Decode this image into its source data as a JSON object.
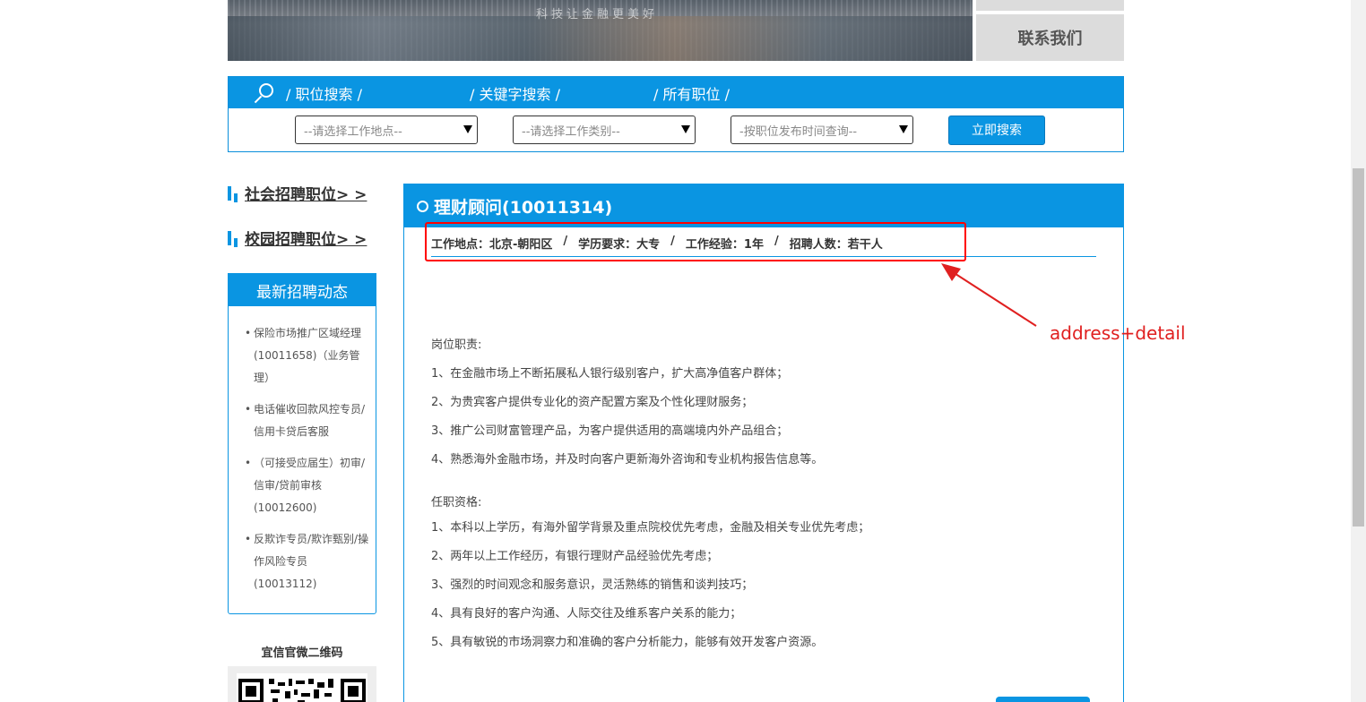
{
  "banner": {
    "slogan": "科技让金融更美好",
    "contact_label": "联系我们"
  },
  "search": {
    "tabs": [
      "/ 职位搜索 /",
      "/ 关键字搜索 /",
      "/ 所有职位 /"
    ],
    "location_placeholder": "--请选择工作地点--",
    "category_placeholder": "--请选择工作类别--",
    "time_placeholder": "-按职位发布时间查询--",
    "submit_label": "立即搜索"
  },
  "sidebar": {
    "links": [
      "社会招聘职位> >",
      "校园招聘职位> >"
    ],
    "news_title": "最新招聘动态",
    "news_items": [
      "保险市场推广区域经理(10011658)（业务管理）",
      "电话催收回款风控专员/信用卡贷后客服",
      "（可接受应届生）初审/信审/贷前审核(10012600)",
      "反欺诈专员/欺诈甄别/操作风险专员(10013112)"
    ],
    "qr_title": "宜信官微二维码"
  },
  "job": {
    "title": "理财顾问(10011314)",
    "meta": {
      "location": "工作地点：北京-朝阳区",
      "education": "学历要求：大专",
      "experience": "工作经验：1年",
      "headcount": "招聘人数：若干人",
      "separator": "/"
    },
    "duties_heading": "岗位职责:",
    "duties": [
      "1、在金融市场上不断拓展私人银行级别客户，扩大高净值客户群体；",
      "2、为贵宾客户提供专业化的资产配置方案及个性化理财服务；",
      "3、推广公司财富管理产品，为客户提供适用的高端境内外产品组合；",
      "4、熟悉海外金融市场，并及时向客户更新海外咨询和专业机构报告信息等。"
    ],
    "requirements_heading": "任职资格:",
    "requirements": [
      "1、本科以上学历，有海外留学背景及重点院校优先考虑，金融及相关专业优先考虑；",
      "2、两年以上工作经历，有银行理财产品经验优先考虑；",
      "3、强烈的时间观念和服务意识，灵活熟练的销售和谈判技巧；",
      "4、具有良好的客户沟通、人际交往及维系客户关系的能力；",
      "5、具有敏锐的市场洞察力和准确的客户分析能力，能够有效开发客户资源。"
    ]
  },
  "annotation": {
    "label": "address+detail",
    "color": "#e02020"
  },
  "colors": {
    "brand_blue": "#0a95e2"
  }
}
